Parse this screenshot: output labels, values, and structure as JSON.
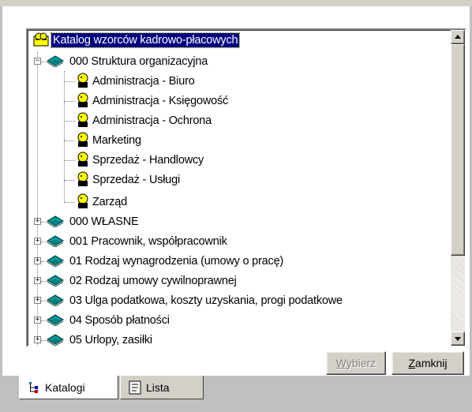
{
  "tree": {
    "root": {
      "label": "Katalog wzorców kadrowo-płacowych",
      "icon": "catalog-root-icon"
    },
    "items": [
      {
        "label": "000 Struktura organizacyjna",
        "expander": "−",
        "icon": "book-icon"
      },
      {
        "label": "Administracja - Biuro",
        "icon": "person-icon"
      },
      {
        "label": "Administracja - Księgowość",
        "icon": "person-icon"
      },
      {
        "label": "Administracja - Ochrona",
        "icon": "person-icon"
      },
      {
        "label": "Marketing",
        "icon": "person-icon"
      },
      {
        "label": "Sprzedaż - Handlowcy",
        "icon": "person-icon"
      },
      {
        "label": "Sprzedaż - Usługi",
        "icon": "person-icon"
      },
      {
        "label": "Zarząd",
        "icon": "person-icon"
      },
      {
        "label": "000 WŁASNE",
        "expander": "+",
        "icon": "book-icon"
      },
      {
        "label": "001 Pracownik, współpracownik",
        "expander": "+",
        "icon": "book-icon"
      },
      {
        "label": "01 Rodzaj wynagrodzenia (umowy o pracę)",
        "expander": "+",
        "icon": "book-icon"
      },
      {
        "label": "02 Rodzaj umowy cywilnoprawnej",
        "expander": "+",
        "icon": "book-icon"
      },
      {
        "label": "03 Ulga podatkowa, koszty uzyskania, progi podatkowe",
        "expander": "+",
        "icon": "book-icon"
      },
      {
        "label": "04 Sposób płatności",
        "expander": "+",
        "icon": "book-icon"
      },
      {
        "label": "05 Urlopy, zasiłki",
        "expander": "+",
        "icon": "book-icon"
      }
    ]
  },
  "buttons": {
    "select": {
      "prefix": "",
      "accel": "W",
      "rest": "ybierz",
      "enabled": false
    },
    "close": {
      "prefix": "",
      "accel": "Z",
      "rest": "amknij",
      "enabled": true
    }
  },
  "tabs": [
    {
      "label": "Katalogi",
      "icon": "tree-icon",
      "active": true
    },
    {
      "label": "Lista",
      "icon": "list-icon",
      "active": false
    }
  ],
  "colors": {
    "selection": "#000080",
    "face": "#d4d0c8",
    "teal": "#008080",
    "yellow": "#ffff00"
  }
}
